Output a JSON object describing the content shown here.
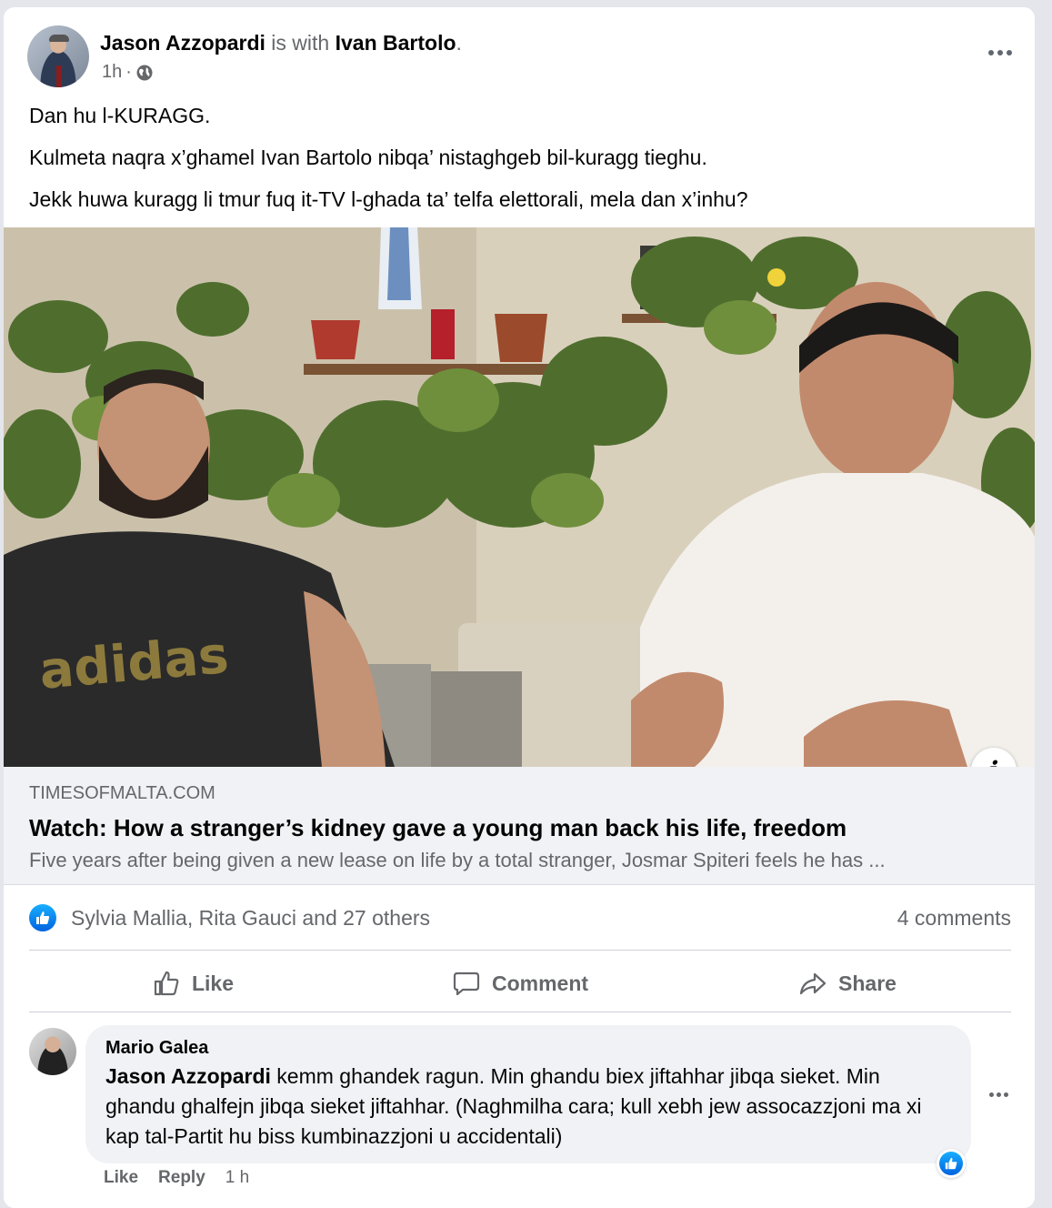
{
  "post": {
    "author": "Jason Azzopardi",
    "with_text": "is with",
    "tagged": "Ivan Bartolo",
    "period": ".",
    "time": "1h",
    "dot": "·",
    "paragraphs": [
      "Dan hu l-KURAGG.",
      "Kulmeta naqra x’ghamel Ivan Bartolo nibqa’ nistaghgeb bil-kuragg tieghu.",
      "Jekk huwa kuragg li tmur fuq it-TV l-ghada ta’ telfa elettorali, mela dan x’inhu?"
    ],
    "more_icon": "ellipsis-icon",
    "privacy_icon": "globe-icon"
  },
  "media": {
    "info_label": "i",
    "shirt_text": "adidas"
  },
  "link": {
    "domain": "TIMESOFMALTA.COM",
    "title": "Watch: How a stranger’s kidney gave a young man back his life, freedom",
    "description": "Five years after being given a new lease on life by a total stranger, Josmar Spiteri feels he has ..."
  },
  "reactions": {
    "names": "Sylvia Mallia, Rita Gauci and 27 others",
    "comments": "4 comments"
  },
  "actions": {
    "like": "Like",
    "comment": "Comment",
    "share": "Share"
  },
  "comment": {
    "author": "Mario Galea",
    "tag": "Jason Azzopardi",
    "text": " kemm ghandek ragun. Min ghandu biex jiftahhar jibqa sieket. Min ghandu ghalfejn jibqa sieket jiftahhar. (Naghmilha cara; kull xebh jew assocazzjoni ma xi kap tal-Partit hu biss kumbinazzjoni u accidentali)",
    "like": "Like",
    "reply": "Reply",
    "time": "1 h"
  },
  "colors": {
    "facebook_blue": "#0866ff",
    "muted": "#65676b",
    "bubble": "#f0f2f5"
  }
}
